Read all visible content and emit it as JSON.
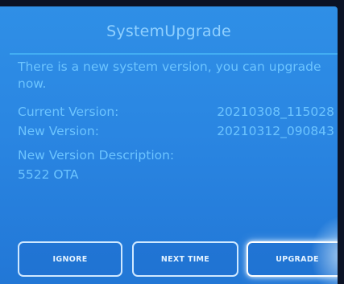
{
  "dialog": {
    "title": "SystemUpgrade",
    "message": "There is a new system version, you can upgrade now.",
    "current_version_label": "Current Version:",
    "current_version_value": "20210308_115028",
    "new_version_label": "New Version:",
    "new_version_value": "20210312_090843",
    "description_label": "New Version Description:",
    "description_value": "5522 OTA"
  },
  "buttons": {
    "ignore": "IGNORE",
    "next_time": "NEXT TIME",
    "upgrade": "UPGRADE"
  },
  "colors": {
    "background": "#2a86e2",
    "title_text": "#8fd0ff",
    "body_text": "#6cc4ff",
    "divider": "#47b3f5",
    "button_border": "#cfe8ff"
  }
}
